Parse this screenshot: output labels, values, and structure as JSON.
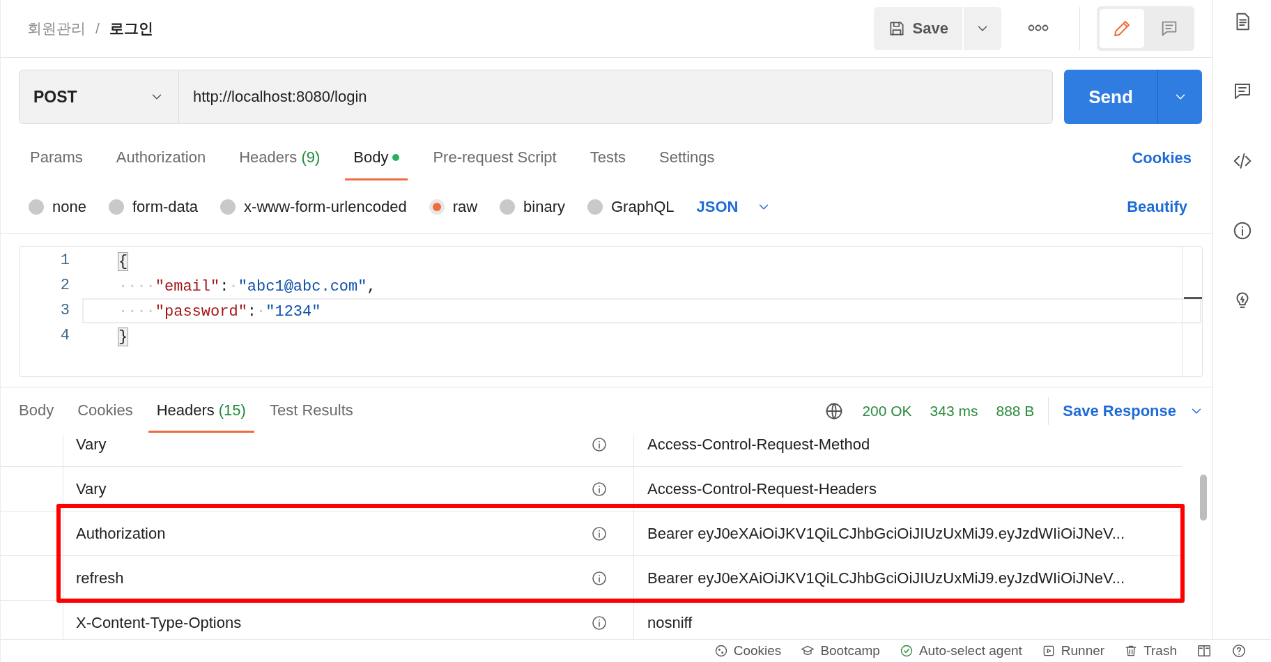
{
  "breadcrumb": {
    "parent": "회원관리",
    "separator": "/",
    "current": "로그인"
  },
  "toolbar": {
    "save_label": "Save",
    "modes": [
      {
        "kind": "edit",
        "selected": true
      },
      {
        "kind": "comment",
        "selected": false
      }
    ]
  },
  "request": {
    "method": "POST",
    "url": "http://localhost:8080/login",
    "send_label": "Send"
  },
  "request_tabs": [
    {
      "label": "Params",
      "selected": false
    },
    {
      "label": "Authorization",
      "selected": false
    },
    {
      "label": "Headers",
      "count": "(9)",
      "selected": false
    },
    {
      "label": "Body",
      "selected": true,
      "modified": true
    },
    {
      "label": "Pre-request Script",
      "selected": false
    },
    {
      "label": "Tests",
      "selected": false
    },
    {
      "label": "Settings",
      "selected": false
    }
  ],
  "cookies_link": "Cookies",
  "body_types": [
    {
      "label": "none",
      "selected": false
    },
    {
      "label": "form-data",
      "selected": false
    },
    {
      "label": "x-www-form-urlencoded",
      "selected": false
    },
    {
      "label": "raw",
      "selected": true
    },
    {
      "label": "binary",
      "selected": false
    },
    {
      "label": "GraphQL",
      "selected": false
    }
  ],
  "format": "JSON",
  "beautify_link": "Beautify",
  "editor_lines": [
    {
      "number": "1",
      "active": false,
      "tokens": [
        {
          "kind": "bracket",
          "text": "{"
        }
      ]
    },
    {
      "number": "2",
      "active": false,
      "tokens": [
        {
          "kind": "ws",
          "text": "····"
        },
        {
          "kind": "key",
          "text": "\"email\""
        },
        {
          "kind": "punct",
          "text": ":"
        },
        {
          "kind": "ws",
          "text": "·"
        },
        {
          "kind": "string",
          "text": "\"abc1@abc.com\""
        },
        {
          "kind": "punct",
          "text": ","
        }
      ]
    },
    {
      "number": "3",
      "active": true,
      "tokens": [
        {
          "kind": "ws",
          "text": "····"
        },
        {
          "kind": "key",
          "text": "\"password\""
        },
        {
          "kind": "punct",
          "text": ":"
        },
        {
          "kind": "ws",
          "text": "·"
        },
        {
          "kind": "string",
          "text": "\"1234\""
        }
      ]
    },
    {
      "number": "4",
      "active": false,
      "tokens": [
        {
          "kind": "bracket",
          "text": "}"
        }
      ]
    }
  ],
  "response_tabs": [
    {
      "label": "Body",
      "selected": false
    },
    {
      "label": "Cookies",
      "selected": false
    },
    {
      "label": "Headers",
      "count": "(15)",
      "selected": true
    },
    {
      "label": "Test Results",
      "selected": false
    }
  ],
  "response_status": {
    "status": "200 OK",
    "time": "343 ms",
    "size": "888 B",
    "save_label": "Save Response"
  },
  "response_headers": [
    {
      "key": "Vary",
      "value": "Access-Control-Request-Method",
      "highlighted": false
    },
    {
      "key": "Vary",
      "value": "Access-Control-Request-Headers",
      "highlighted": false
    },
    {
      "key": "Authorization",
      "value": "Bearer eyJ0eXAiOiJKV1QiLCJhbGciOiJIUzUxMiJ9.eyJzdWIiOiJNeV...",
      "highlighted": true
    },
    {
      "key": "refresh",
      "value": "Bearer eyJ0eXAiOiJKV1QiLCJhbGciOiJIUzUxMiJ9.eyJzdWIiOiJNeV...",
      "highlighted": true
    },
    {
      "key": "X-Content-Type-Options",
      "value": "nosniff",
      "highlighted": false
    }
  ],
  "status_bar": [
    {
      "kind": "cookie",
      "label": "Cookies"
    },
    {
      "kind": "cap",
      "label": "Bootcamp"
    },
    {
      "kind": "check",
      "label": "Auto-select agent"
    },
    {
      "kind": "play",
      "label": "Runner"
    },
    {
      "kind": "trash",
      "label": "Trash"
    },
    {
      "kind": "layout"
    },
    {
      "kind": "help"
    }
  ]
}
